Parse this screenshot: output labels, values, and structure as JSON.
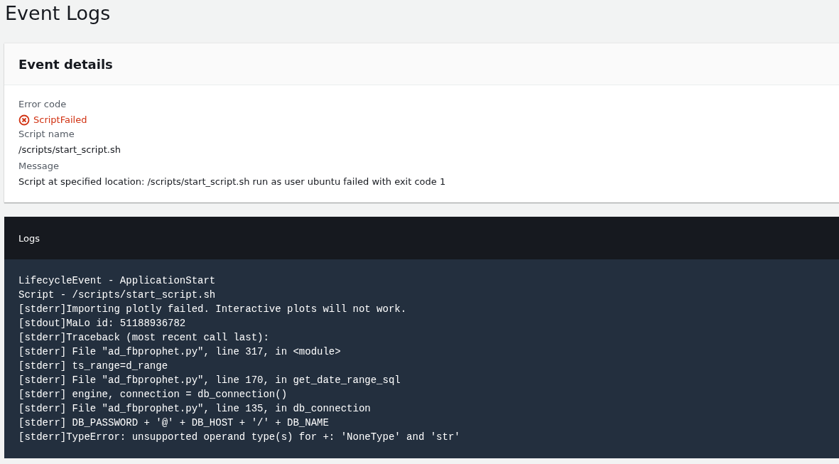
{
  "page": {
    "title": "Event Logs"
  },
  "event_details": {
    "title": "Event details",
    "fields": [
      {
        "label": "Error code",
        "value": "ScriptFailed",
        "kind": "error"
      },
      {
        "label": "Script name",
        "value": "/scripts/start_script.sh",
        "kind": "text"
      },
      {
        "label": "Message",
        "value": "Script at specified location: /scripts/start_script.sh run as user ubuntu failed with exit code 1",
        "kind": "text"
      }
    ]
  },
  "logs": {
    "title": "Logs",
    "lines": [
      "LifecycleEvent - ApplicationStart",
      "Script - /scripts/start_script.sh",
      "[stderr]Importing plotly failed. Interactive plots will not work.",
      "[stdout]MaLo id: 51188936782",
      "[stderr]Traceback (most recent call last):",
      "[stderr] File \"ad_fbprophet.py\", line 317, in <module>",
      "[stderr] ts_range=d_range",
      "[stderr] File \"ad_fbprophet.py\", line 170, in get_date_range_sql",
      "[stderr] engine, connection = db_connection()",
      "[stderr] File \"ad_fbprophet.py\", line 135, in db_connection",
      "[stderr] DB_PASSWORD + '@' + DB_HOST + '/' + DB_NAME",
      "[stderr]TypeError: unsupported operand type(s) for +: 'NoneType' and 'str'"
    ]
  }
}
